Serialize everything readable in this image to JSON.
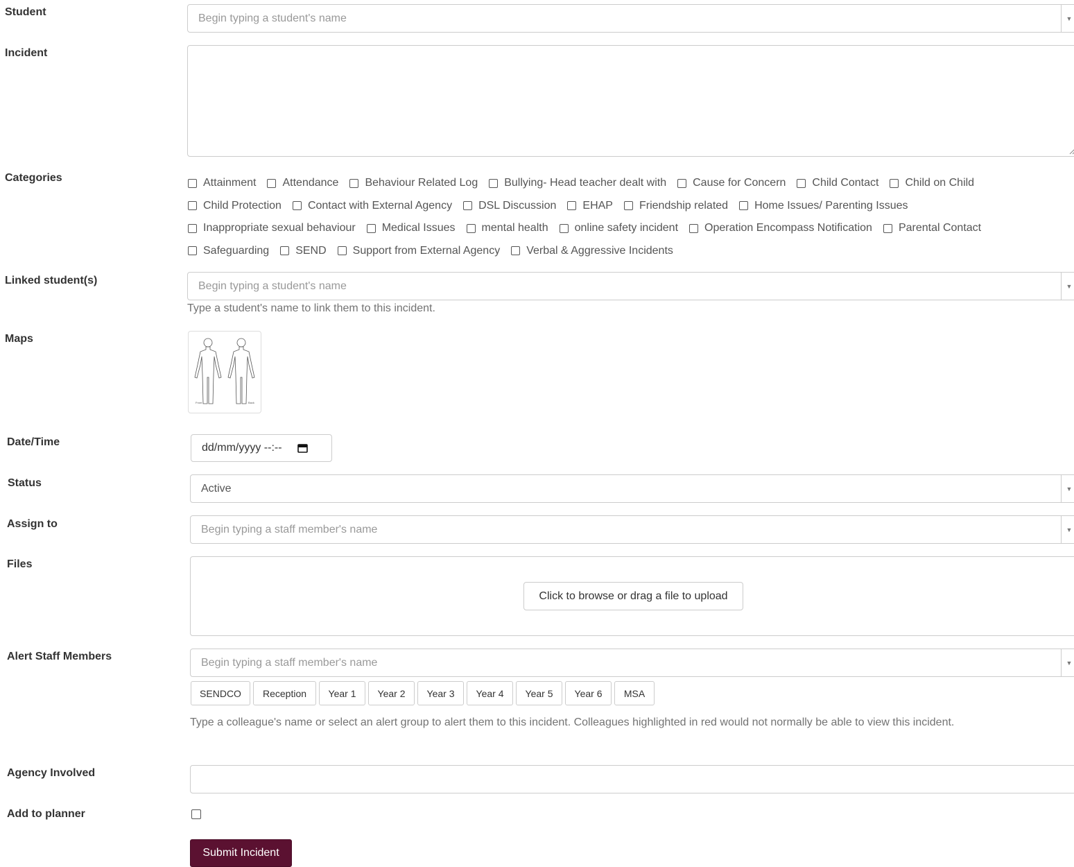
{
  "form": {
    "student": {
      "label": "Student",
      "placeholder": "Begin typing a student's name"
    },
    "incident": {
      "label": "Incident",
      "value": ""
    },
    "categories": {
      "label": "Categories",
      "rows": [
        [
          "Attainment",
          "Attendance",
          "Behaviour Related Log",
          "Bullying- Head teacher dealt with",
          "Cause for Concern",
          "Child Contact",
          "Child on Child"
        ],
        [
          "Child Protection",
          "Contact with External Agency",
          "DSL Discussion",
          "EHAP",
          "Friendship related",
          "Home Issues/ Parenting Issues"
        ],
        [
          "Inappropriate sexual behaviour",
          "Medical Issues",
          "mental health",
          "online safety incident",
          "Operation Encompass Notification",
          "Parental Contact"
        ],
        [
          "Safeguarding",
          "SEND",
          "Support from External Agency",
          "Verbal & Aggressive Incidents"
        ]
      ]
    },
    "linked_students": {
      "label": "Linked student(s)",
      "placeholder": "Begin typing a student's name",
      "help": "Type a student's name to link them to this incident."
    },
    "maps": {
      "label": "Maps",
      "thumbnail_captions": [
        "Front",
        "Back"
      ]
    },
    "datetime": {
      "label": "Date/Time",
      "placeholder": "dd/mm/yyyy --:--"
    },
    "status": {
      "label": "Status",
      "value": "Active"
    },
    "assign_to": {
      "label": "Assign to",
      "placeholder": "Begin typing a staff member's name"
    },
    "files": {
      "label": "Files",
      "upload_label": "Click to browse or drag a file to upload"
    },
    "alert_staff": {
      "label": "Alert Staff Members",
      "placeholder": "Begin typing a staff member's name",
      "groups": [
        "SENDCO",
        "Reception",
        "Year 1",
        "Year 2",
        "Year 3",
        "Year 4",
        "Year 5",
        "Year 6",
        "MSA"
      ],
      "help": "Type a colleague's name or select an alert group to alert them to this incident. Colleagues highlighted in red would not normally be able to view this incident."
    },
    "agency_involved": {
      "label": "Agency Involved",
      "value": ""
    },
    "add_to_planner": {
      "label": "Add to planner",
      "checked": false
    },
    "submit_label": "Submit Incident"
  },
  "colors": {
    "submit_bg": "#5b1131",
    "border": "#cccccc",
    "label_text": "#333333",
    "placeholder_text": "#999999",
    "help_text": "#737373"
  },
  "icons": {
    "dropdown": "caret-down-icon",
    "calendar": "calendar-icon",
    "resize": "resize-grip-icon"
  }
}
